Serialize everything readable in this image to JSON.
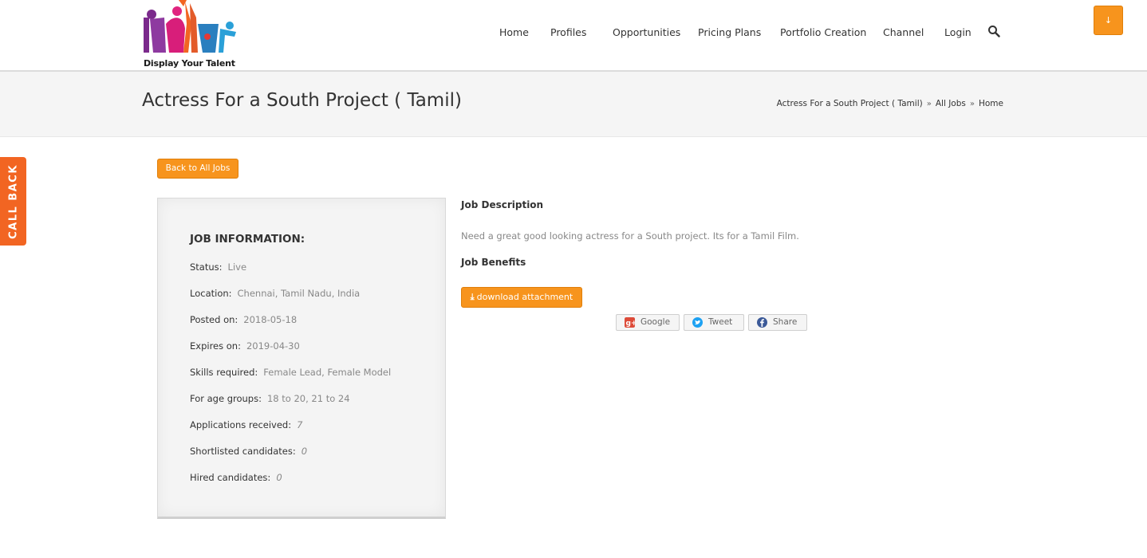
{
  "header": {
    "logo_caption": "Display Your Talent",
    "nav": [
      {
        "label": "Home"
      },
      {
        "label": "Profiles"
      },
      {
        "label": "Opportunities"
      },
      {
        "label": "Pricing Plans"
      },
      {
        "label": "Portfolio Creation"
      },
      {
        "label": "Channel"
      },
      {
        "label": "Login"
      }
    ],
    "corner_button_icon": "arrow-down-icon",
    "corner_button_label": "↓"
  },
  "title_bar": {
    "page_title": "Actress For a South Project ( Tamil)",
    "breadcrumb": [
      "Actress For a South Project ( Tamil)",
      "All Jobs",
      "Home"
    ],
    "breadcrumb_separator": "»"
  },
  "callback_tab": {
    "label": "CALL BACK",
    "color": "#f26522"
  },
  "back_button": {
    "label": "Back to All Jobs"
  },
  "job_info": {
    "heading": "JOB INFORMATION:",
    "rows": [
      {
        "label": "Status:",
        "value": "Live"
      },
      {
        "label": "Location:",
        "value": "Chennai, Tamil Nadu, India"
      },
      {
        "label": "Posted on:",
        "value": "2018-05-18"
      },
      {
        "label": "Expires on:",
        "value": "2019-04-30"
      },
      {
        "label": "Skills required:",
        "value": "Female Lead, Female Model"
      },
      {
        "label": "For age groups:",
        "value": "18 to 20, 21 to 24"
      },
      {
        "label": "Applications received:",
        "value": "7"
      },
      {
        "label": "Shortlisted candidates:",
        "value": "0"
      },
      {
        "label": "Hired candidates:",
        "value": "0"
      }
    ]
  },
  "job_detail": {
    "description_heading": "Job Description",
    "description": "Need a great good looking actress for a South project. Its for a Tamil Film.",
    "benefits_heading": "Job Benefits",
    "download_label": "download attachment"
  },
  "share": [
    {
      "label": "Google",
      "icon": "google-plus-icon"
    },
    {
      "label": "Tweet",
      "icon": "twitter-icon"
    },
    {
      "label": "Share",
      "icon": "facebook-icon"
    }
  ],
  "colors": {
    "accent": "#f7941d",
    "callback": "#f26522"
  }
}
